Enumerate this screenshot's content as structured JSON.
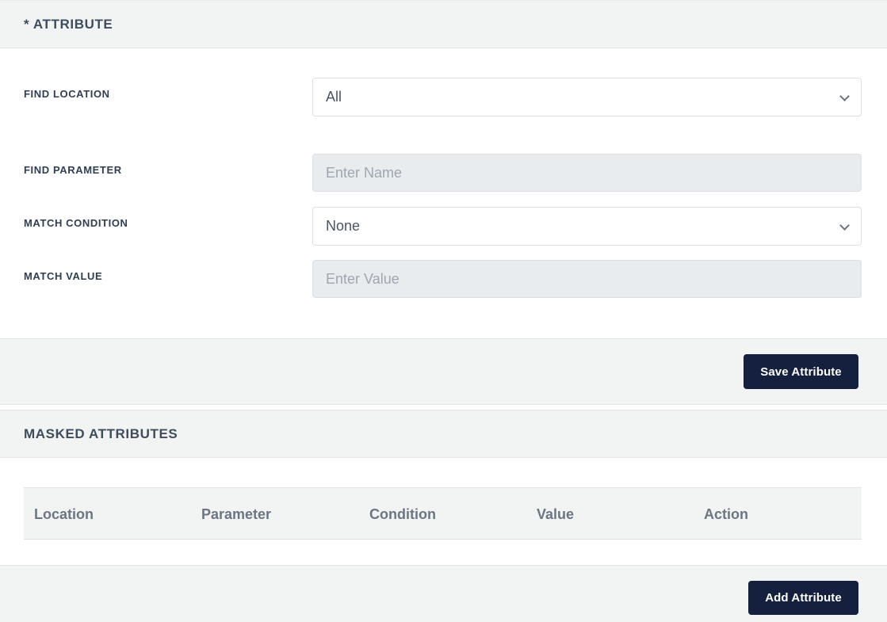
{
  "attribute_section": {
    "title": "* ATTRIBUTE",
    "find_location": {
      "label": "FIND LOCATION",
      "selected": "All"
    },
    "find_parameter": {
      "label": "FIND PARAMETER",
      "placeholder": "Enter Name"
    },
    "match_condition": {
      "label": "MATCH CONDITION",
      "selected": "None"
    },
    "match_value": {
      "label": "MATCH VALUE",
      "placeholder": "Enter Value"
    },
    "save_label": "Save Attribute"
  },
  "masked_section": {
    "title": "MASKED ATTRIBUTES",
    "columns": [
      "Location",
      "Parameter",
      "Condition",
      "Value",
      "Action"
    ],
    "add_label": "Add Attribute"
  },
  "colors": {
    "button_bg": "#14203e",
    "header_bg": "#f2f3f3",
    "disabled_input_bg": "#e9ecef"
  }
}
